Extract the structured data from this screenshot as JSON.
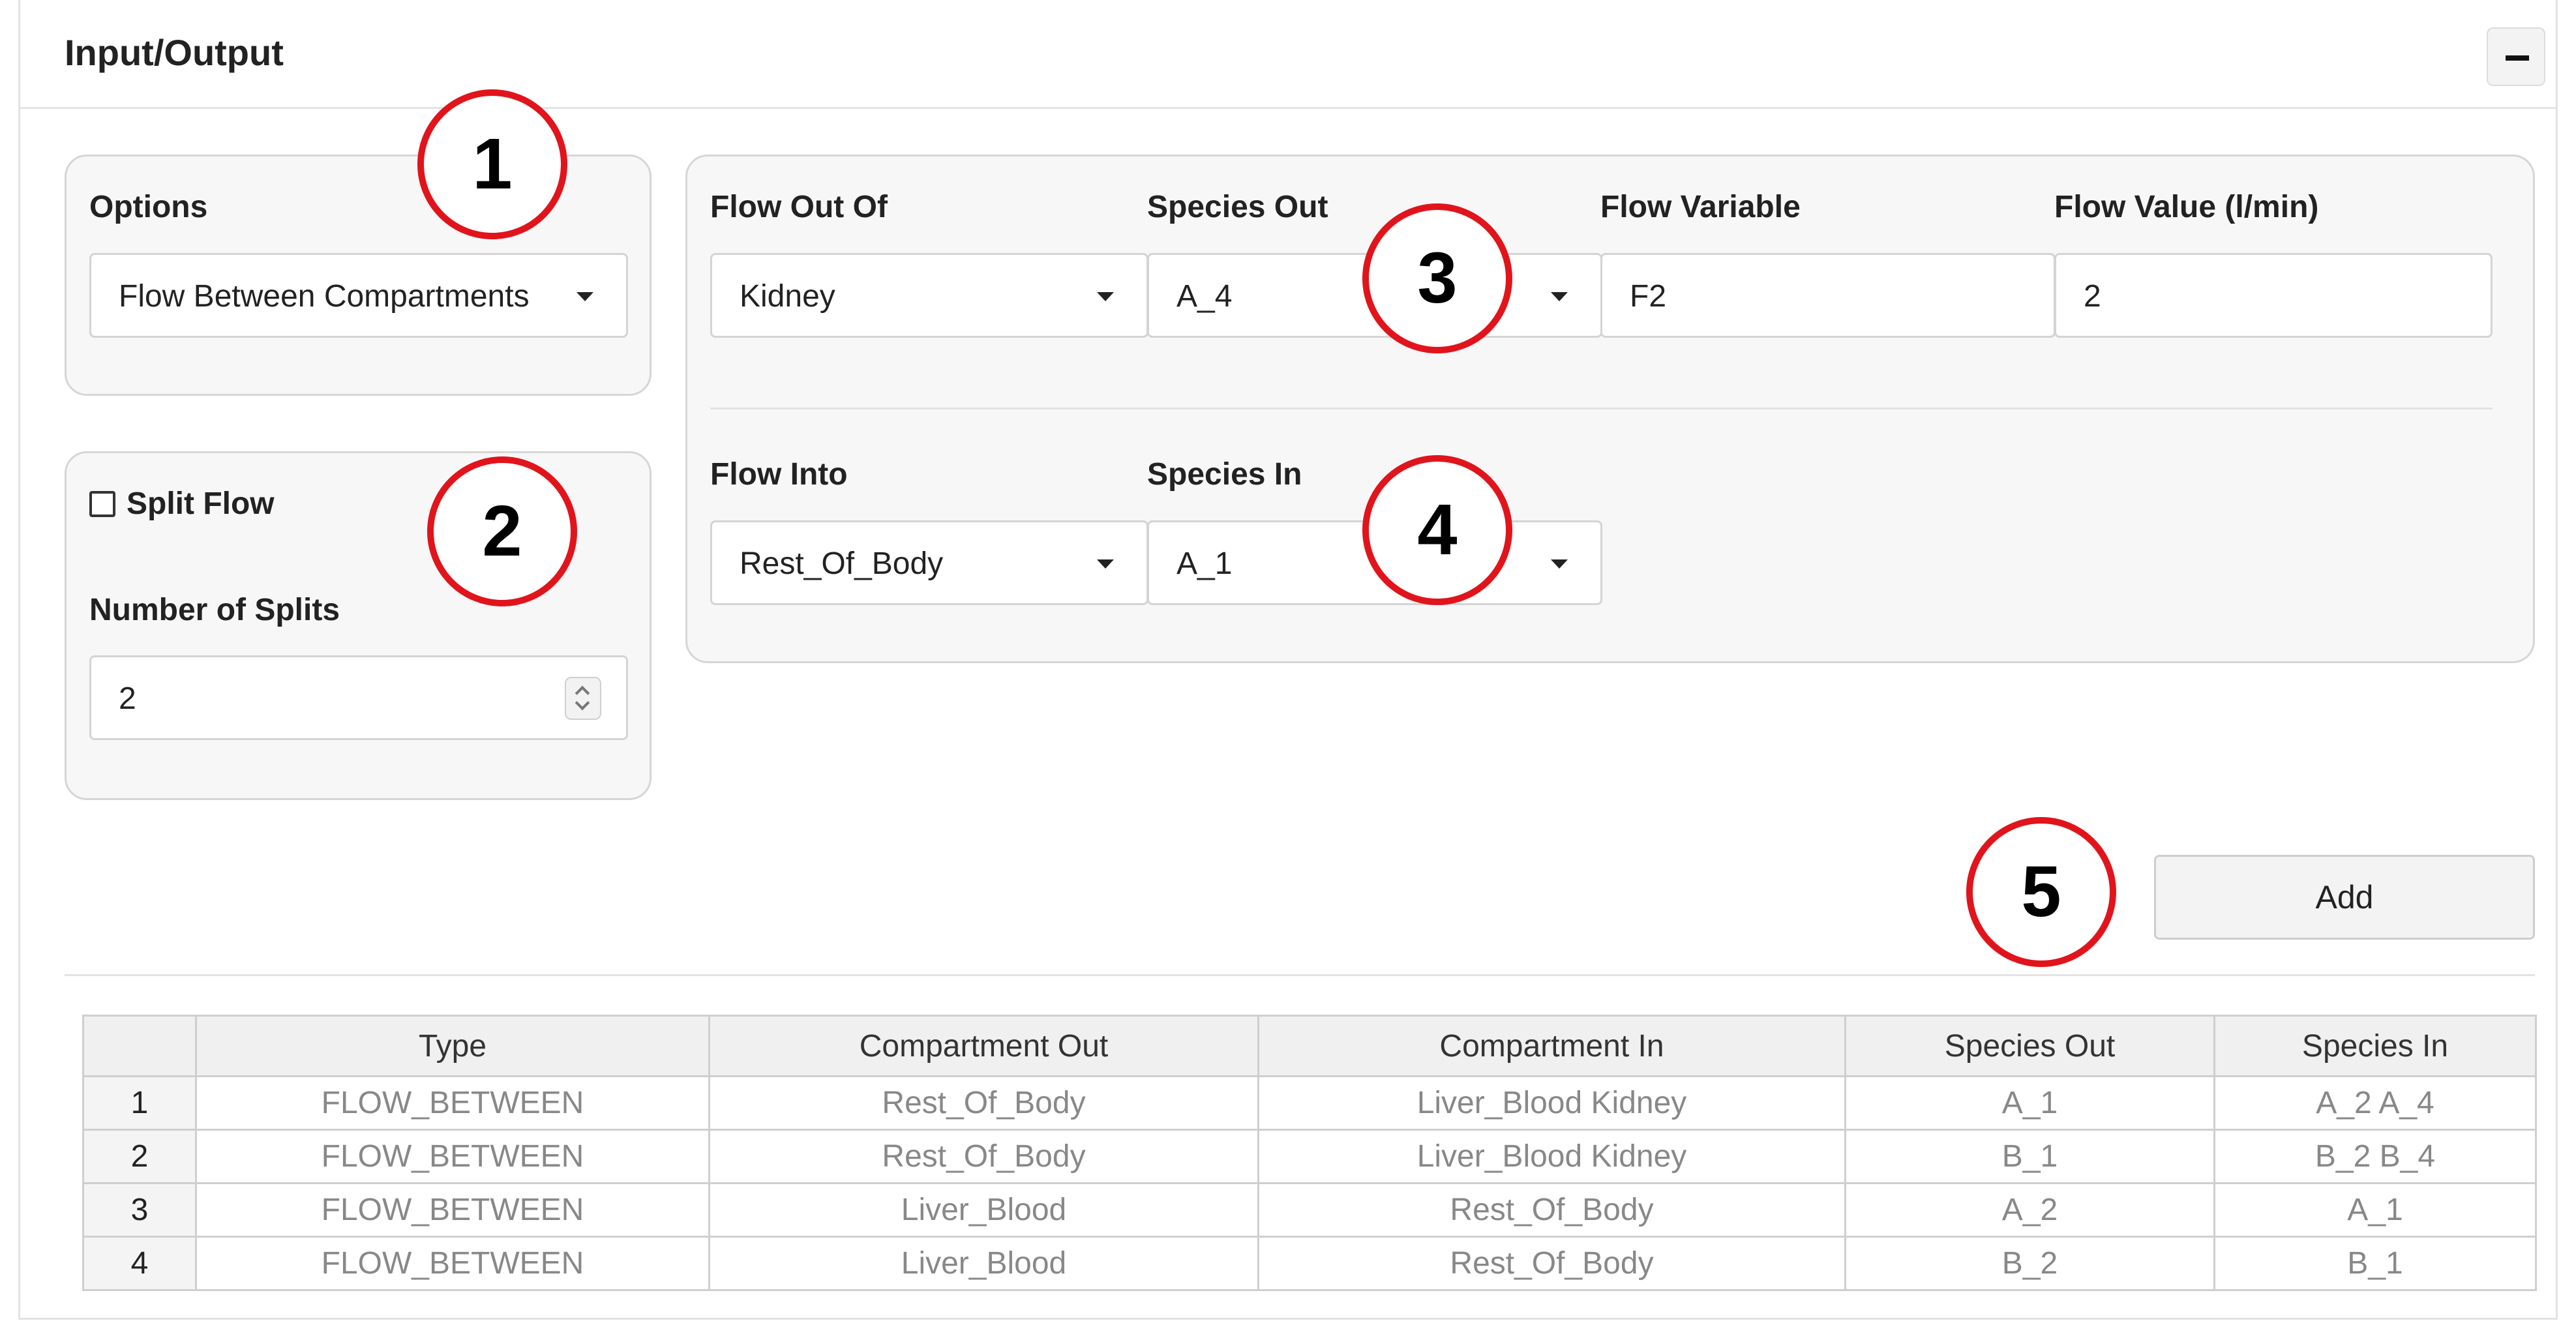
{
  "panel": {
    "title": "Input/Output",
    "collapse_symbol": "−"
  },
  "options_card": {
    "label": "Options",
    "select_value": "Flow Between Compartments"
  },
  "split_card": {
    "checkbox_label": "Split Flow",
    "checked": false,
    "splits_label": "Number of Splits",
    "splits_value": "2"
  },
  "flow_card": {
    "flow_out_label": "Flow Out Of",
    "flow_out_value": "Kidney",
    "species_out_label": "Species Out",
    "species_out_value": "A_4",
    "flow_variable_label": "Flow Variable",
    "flow_variable_value": "F2",
    "flow_value_label": "Flow Value (l/min)",
    "flow_value_value": "2",
    "flow_into_label": "Flow Into",
    "flow_into_value": "Rest_Of_Body",
    "species_in_label": "Species In",
    "species_in_value": "A_1"
  },
  "add_button": {
    "label": "Add"
  },
  "annotations": [
    "1",
    "2",
    "3",
    "4",
    "5"
  ],
  "table": {
    "headers": [
      "",
      "Type",
      "Compartment Out",
      "Compartment In",
      "Species Out",
      "Species In"
    ],
    "rows": [
      [
        "1",
        "FLOW_BETWEEN",
        "Rest_Of_Body",
        "Liver_Blood Kidney",
        "A_1",
        "A_2 A_4"
      ],
      [
        "2",
        "FLOW_BETWEEN",
        "Rest_Of_Body",
        "Liver_Blood Kidney",
        "B_1",
        "B_2 B_4"
      ],
      [
        "3",
        "FLOW_BETWEEN",
        "Liver_Blood",
        "Rest_Of_Body",
        "A_2",
        "A_1"
      ],
      [
        "4",
        "FLOW_BETWEEN",
        "Liver_Blood",
        "Rest_Of_Body",
        "B_2",
        "B_1"
      ]
    ]
  },
  "colors": {
    "annotation_ring": "#e1141c",
    "card_background": "#f7f7f7",
    "table_text": "#888888"
  },
  "icons": {
    "collapse": "minus-icon",
    "dropdown": "caret-down-icon",
    "spinner": "spinner-icon",
    "checkbox": "checkbox-icon"
  }
}
